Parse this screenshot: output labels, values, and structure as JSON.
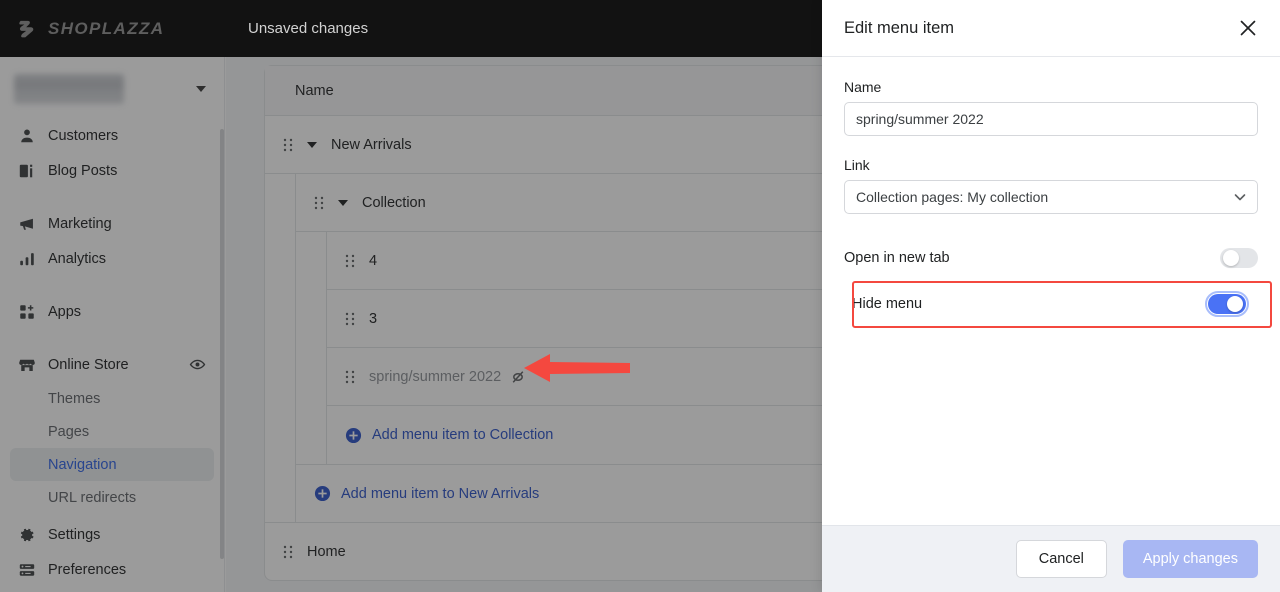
{
  "topbar": {
    "brand": "SHOPLAZZA",
    "brand_icon": "shoplazza-logo-icon",
    "unsaved_label": "Unsaved changes"
  },
  "sidebar": {
    "store_switcher": {
      "name_redacted": "",
      "chevron_icon": "chevron-down-icon"
    },
    "items": [
      {
        "label": "Customers",
        "icon": "person-icon"
      },
      {
        "label": "Blog Posts",
        "icon": "blog-icon"
      },
      {
        "label": "Marketing",
        "icon": "megaphone-icon"
      },
      {
        "label": "Analytics",
        "icon": "bar-chart-icon"
      },
      {
        "label": "Apps",
        "icon": "apps-icon"
      },
      {
        "label": "Online Store",
        "icon": "storefront-icon",
        "trailing_icon": "eye-icon"
      },
      {
        "label": "Settings",
        "icon": "gear-icon"
      },
      {
        "label": "Preferences",
        "icon": "preferences-icon"
      }
    ],
    "online_store_children": [
      {
        "label": "Themes",
        "active": false
      },
      {
        "label": "Pages",
        "active": false
      },
      {
        "label": "Navigation",
        "active": true
      },
      {
        "label": "URL redirects",
        "active": false
      }
    ],
    "active_color": "#2f63e8"
  },
  "main": {
    "table_header": {
      "name": "Name"
    },
    "rows": [
      {
        "label": "New Arrivals",
        "level": 0,
        "has_caret": true,
        "hidden": false
      },
      {
        "label": "Collection",
        "level": 1,
        "has_caret": true,
        "hidden": false
      },
      {
        "label": "4",
        "level": 2,
        "has_caret": false,
        "hidden": false
      },
      {
        "label": "3",
        "level": 2,
        "has_caret": false,
        "hidden": false
      },
      {
        "label": "spring/summer 2022",
        "level": 2,
        "has_caret": false,
        "hidden": true,
        "hidden_icon": "eye-off-icon"
      }
    ],
    "add_collection_link": "Add menu item to Collection",
    "add_new_arrivals_link": "Add menu item to New Arrivals",
    "home_row": "Home"
  },
  "annotations": {
    "arrow_color": "#f4483f",
    "highlight_box_color": "#f4483f"
  },
  "drawer": {
    "title": "Edit menu item",
    "close_icon": "close-icon",
    "name_label": "Name",
    "name_value": "spring/summer 2022",
    "link_label": "Link",
    "link_value": "Collection pages: My collection",
    "link_chevron_icon": "chevron-down-icon",
    "open_new_tab_label": "Open in new tab",
    "open_new_tab_on": false,
    "hide_menu_label": "Hide menu",
    "hide_menu_on": true,
    "cancel_label": "Cancel",
    "apply_label": "Apply changes",
    "toggle_on_color": "#4a72f5"
  }
}
